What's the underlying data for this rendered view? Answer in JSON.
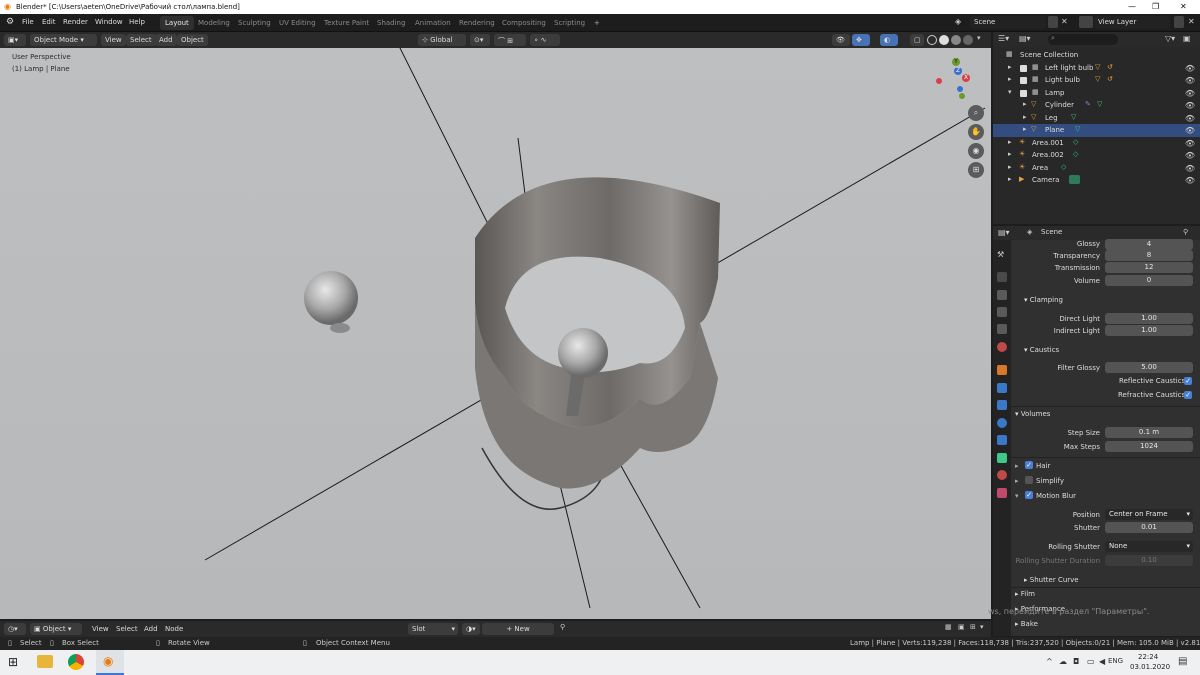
{
  "titlebar": {
    "title": "Blender* [C:\\Users\\aeten\\OneDrive\\Рабочий стол\\лампа.blend]",
    "min": "—",
    "max": "❐",
    "close": "✕"
  },
  "menu": {
    "items": [
      "File",
      "Edit",
      "Render",
      "Window",
      "Help"
    ]
  },
  "workspaces": [
    "Layout",
    "Modeling",
    "Sculpting",
    "UV Editing",
    "Texture Paint",
    "Shading",
    "Animation",
    "Rendering",
    "Compositing",
    "Scripting"
  ],
  "workspace_add": "+",
  "scene": {
    "name": "Scene",
    "view_layer": "View Layer"
  },
  "viewport_header": {
    "mode": "Object Mode",
    "view": "View",
    "select": "Select",
    "add": "Add",
    "object": "Object",
    "orientation": "Global"
  },
  "viewport": {
    "perspective": "User Perspective",
    "object_info": "(1) Lamp | Plane",
    "axis_x": "X",
    "axis_y": "Y",
    "axis_z": "Z"
  },
  "outliner": {
    "root": "Scene Collection",
    "items": [
      {
        "label": "Left light bulb",
        "checked": true
      },
      {
        "label": "Light bulb",
        "checked": true
      },
      {
        "label": "Lamp",
        "checked": true
      },
      {
        "label": "Cylinder"
      },
      {
        "label": "Leg"
      },
      {
        "label": "Plane"
      },
      {
        "label": "Area.001"
      },
      {
        "label": "Area.002"
      },
      {
        "label": "Area"
      },
      {
        "label": "Camera"
      }
    ]
  },
  "properties": {
    "context": "Scene",
    "rows_top": [
      {
        "label": "Glossy",
        "value": "4"
      },
      {
        "label": "Transparency",
        "value": "8"
      },
      {
        "label": "Transmission",
        "value": "12"
      },
      {
        "label": "Volume",
        "value": "0"
      }
    ],
    "clamping": {
      "title": "Clamping",
      "direct_label": "Direct Light",
      "direct": "1.00",
      "indirect_label": "Indirect Light",
      "indirect": "1.00"
    },
    "caustics": {
      "title": "Caustics",
      "filter_label": "Filter Glossy",
      "filter": "5.00",
      "reflective": "Reflective Caustics",
      "refractive": "Refractive Caustics"
    },
    "volumes": {
      "title": "Volumes",
      "step_label": "Step Size",
      "step": "0.1 m",
      "max_label": "Max Steps",
      "max": "1024"
    },
    "hair": "Hair",
    "simplify": "Simplify",
    "motion_blur": {
      "title": "Motion Blur",
      "position_label": "Position",
      "position": "Center on Frame",
      "shutter_label": "Shutter",
      "shutter": "0.01",
      "rolling_label": "Rolling Shutter",
      "rolling": "None",
      "rolling_dur_label": "Rolling Shutter Duration",
      "rolling_dur": "0.10",
      "curve": "Shutter Curve"
    },
    "film": "Film",
    "performance": "Performance",
    "bake": "Bake",
    "watermark": "ws, перейдите в раздел \"Параметры\"."
  },
  "timeline_header": {
    "editor": "Object",
    "view": "View",
    "select": "Select",
    "add": "Add",
    "node": "Node",
    "slot": "Slot",
    "new": "New"
  },
  "statusbar": {
    "select": "Select",
    "box_select": "Box Select",
    "rotate": "Rotate View",
    "context": "Object Context Menu",
    "stats": "Lamp | Plane | Verts:119,238 | Faces:118,738 | Tris:237,520 | Objects:0/21 | Mem: 105.0 MiB | v2.81.16"
  },
  "taskbar": {
    "lang": "ENG",
    "time": "22:24",
    "date": "03.01.2020"
  }
}
